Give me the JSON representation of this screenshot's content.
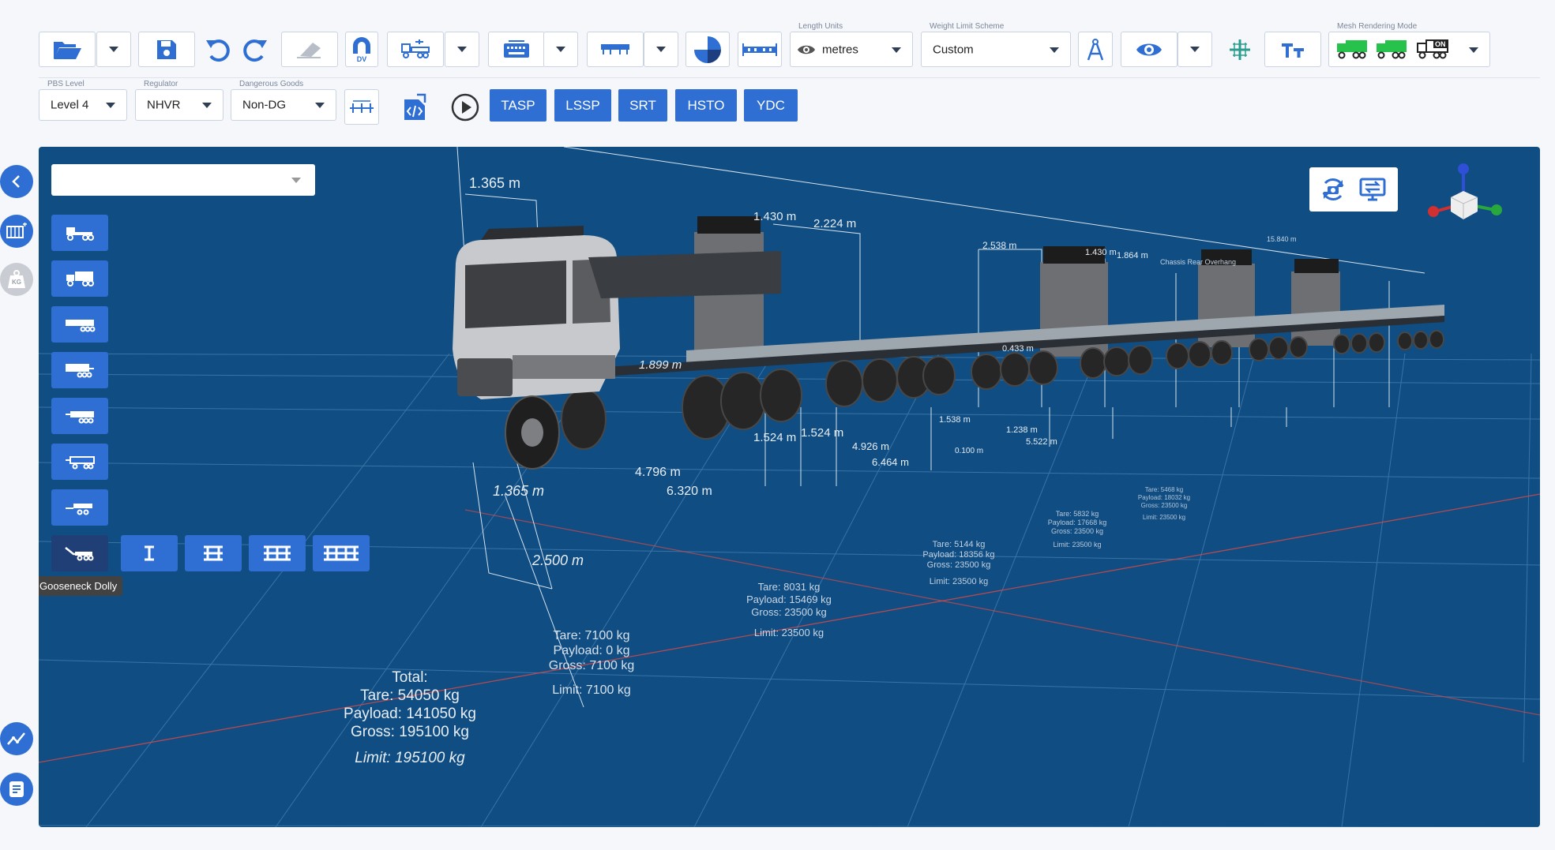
{
  "toolbar": {
    "length_units": {
      "label": "Length Units",
      "value": "metres"
    },
    "weight_limit": {
      "label": "Weight Limit Scheme",
      "value": "Custom"
    },
    "mesh_mode_label": "Mesh Rendering Mode",
    "dv_label": "DV",
    "on_label": "ON"
  },
  "toolbar2": {
    "pbs_level": {
      "label": "PBS Level",
      "value": "Level 4"
    },
    "regulator": {
      "label": "Regulator",
      "value": "NHVR"
    },
    "dangerous_goods": {
      "label": "Dangerous Goods",
      "value": "Non-DG"
    },
    "tests": [
      "TASP",
      "LSSP",
      "SRT",
      "HSTO",
      "YDC"
    ]
  },
  "sidebar": {
    "kg_label": "KG"
  },
  "viewport": {
    "tooltip": "Gooseneck Dolly",
    "search_value": "",
    "dims": {
      "d1": "1.365 m",
      "d2": "1.430 m",
      "d3": "2.224 m",
      "d4": "2.538 m",
      "d5": "1.430 m",
      "d6": "1.864 m",
      "d7": "15.840 m",
      "d8": "Chassis Rear Overhang",
      "d9": "1.899 m",
      "d10": "1.524 m",
      "d11": "1.524 m",
      "d12": "4.926 m",
      "d13": "6.464 m",
      "d14": "4.796 m",
      "d15": "6.320 m",
      "d16": "1.365 m",
      "d17": "2.500 m",
      "d18": "0.433 m",
      "d19": "1.538 m",
      "d20": "1.238 m",
      "d21": "5.522 m",
      "d22": "0.100 m"
    },
    "weights": [
      {
        "tare": "Tare: 7100 kg",
        "payload": "Payload: 0 kg",
        "gross": "Gross: 7100 kg",
        "limit": "Limit: 7100 kg"
      },
      {
        "tare": "Tare: 8031 kg",
        "payload": "Payload: 15469 kg",
        "gross": "Gross: 23500 kg",
        "limit": "Limit: 23500 kg"
      },
      {
        "tare": "Tare: 5144 kg",
        "payload": "Payload: 18356 kg",
        "gross": "Gross: 23500 kg",
        "limit": "Limit: 23500 kg"
      },
      {
        "tare": "Tare: 5832 kg",
        "payload": "Payload: 17668 kg",
        "gross": "Gross: 23500 kg",
        "limit": "Limit: 23500 kg"
      },
      {
        "tare": "Tare: 5468 kg",
        "payload": "Payload: 18032 kg",
        "gross": "Gross: 23500 kg",
        "limit": "Limit: 23500 kg"
      }
    ],
    "total": {
      "title": "Total:",
      "tare": "Tare: 54050 kg",
      "payload": "Payload: 141050 kg",
      "gross": "Gross: 195100 kg",
      "limit": "Limit: 195100 kg"
    }
  },
  "colors": {
    "accent": "#2f6fd3",
    "viewport_bg": "#0f4d82",
    "toolbar_bg": "#f5f7fb",
    "mesh_green": "#27c24c"
  }
}
